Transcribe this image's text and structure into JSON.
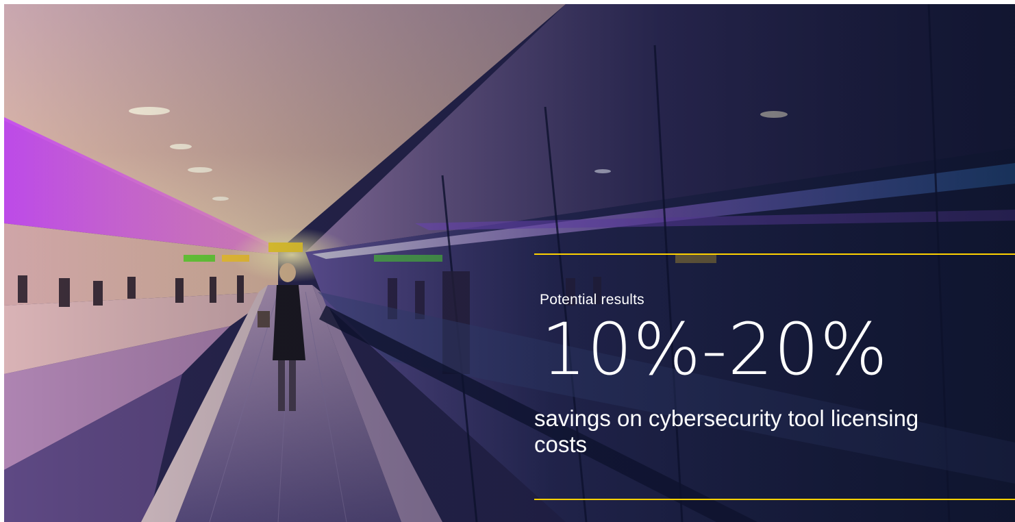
{
  "results": {
    "eyebrow": "Potential results",
    "figure": "10%-20%",
    "caption": "savings on cybersecurity tool licensing costs"
  },
  "colors": {
    "accent_rule": "#ffd200",
    "text": "#ffffff",
    "tunnel_glow": "#b04dff"
  },
  "image": {
    "subject": "hero-photo"
  }
}
